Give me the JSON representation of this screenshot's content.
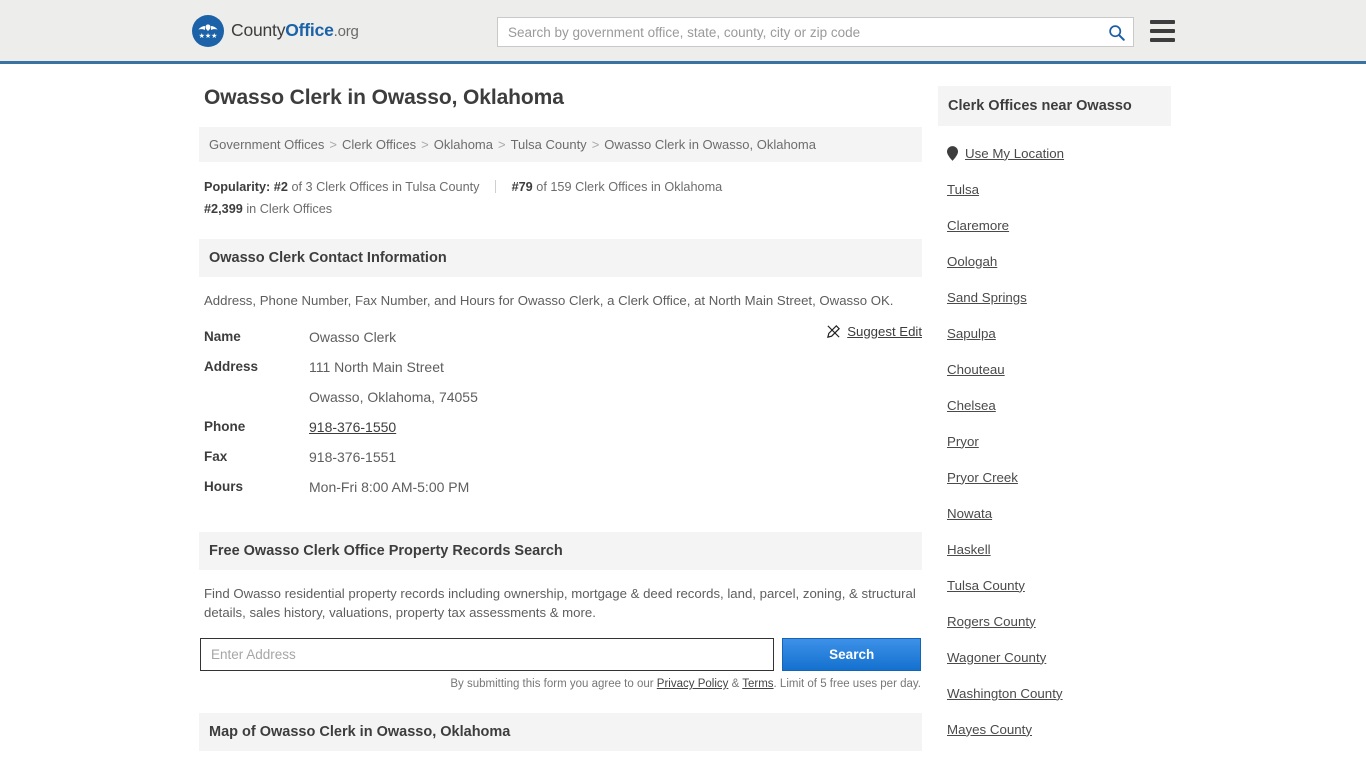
{
  "header": {
    "logo": {
      "text_county": "County",
      "text_office": "Office",
      "text_org": ".org",
      "stars": "★★★"
    },
    "search": {
      "placeholder": "Search by government office, state, county, city or zip code",
      "value": "",
      "icon": "search-icon"
    },
    "menu_icon": "hamburger-menu-icon",
    "accent_color": "#3a72a4",
    "background_color": "#ededeb"
  },
  "main": {
    "page_title": "Owasso Clerk in Owasso, Oklahoma",
    "breadcrumb": {
      "separator": ">",
      "items": [
        "Government Offices",
        "Clerk Offices",
        "Oklahoma",
        "Tulsa County",
        "Owasso Clerk in Owasso, Oklahoma"
      ]
    },
    "popularity": {
      "label": "Popularity:",
      "rank_county_num": "#2",
      "rank_county_text": "of 3 Clerk Offices in Tulsa County",
      "rank_state_num": "#79",
      "rank_state_text": "of 159 Clerk Offices in Oklahoma",
      "rank_all_num": "#2,399",
      "rank_all_text": "in Clerk Offices"
    },
    "contact_section": {
      "heading": "Owasso Clerk Contact Information",
      "description": "Address, Phone Number, Fax Number, and Hours for Owasso Clerk, a Clerk Office, at North Main Street, Owasso OK.",
      "suggest_edit": {
        "label": "Suggest Edit",
        "icon": "edit-pencil-icon"
      },
      "rows": [
        {
          "key": "Name",
          "value": "Owasso Clerk",
          "link": false
        },
        {
          "key": "Address",
          "value": "111 North Main Street",
          "link": false
        },
        {
          "key": "",
          "value": "Owasso, Oklahoma, 74055",
          "link": false
        },
        {
          "key": "Phone",
          "value": "918-376-1550",
          "link": true
        },
        {
          "key": "Fax",
          "value": "918-376-1551",
          "link": false
        },
        {
          "key": "Hours",
          "value": "Mon-Fri 8:00 AM-5:00 PM",
          "link": false
        }
      ]
    },
    "property_section": {
      "heading": "Free Owasso Clerk Office Property Records Search",
      "description": "Find Owasso residential property records including ownership, mortgage & deed records, land, parcel, zoning, & structural details, sales history, valuations, property tax assessments & more.",
      "input_placeholder": "Enter Address",
      "input_value": "",
      "button_label": "Search",
      "note_prefix": "By submitting this form you agree to our ",
      "note_privacy": "Privacy Policy",
      "note_amp": " & ",
      "note_terms": "Terms",
      "note_suffix": ". Limit of 5 free uses per day."
    },
    "map_section": {
      "heading": "Map of Owasso Clerk in Owasso, Oklahoma"
    }
  },
  "sidebar": {
    "heading": "Clerk Offices near Owasso",
    "use_my_location": {
      "label": "Use My Location",
      "icon": "map-pin-icon"
    },
    "items": [
      "Tulsa",
      "Claremore",
      "Oologah",
      "Sand Springs",
      "Sapulpa",
      "Chouteau",
      "Chelsea",
      "Pryor",
      "Pryor Creek",
      "Nowata",
      "Haskell",
      "Tulsa County",
      "Rogers County",
      "Wagoner County",
      "Washington County",
      "Mayes County"
    ]
  }
}
